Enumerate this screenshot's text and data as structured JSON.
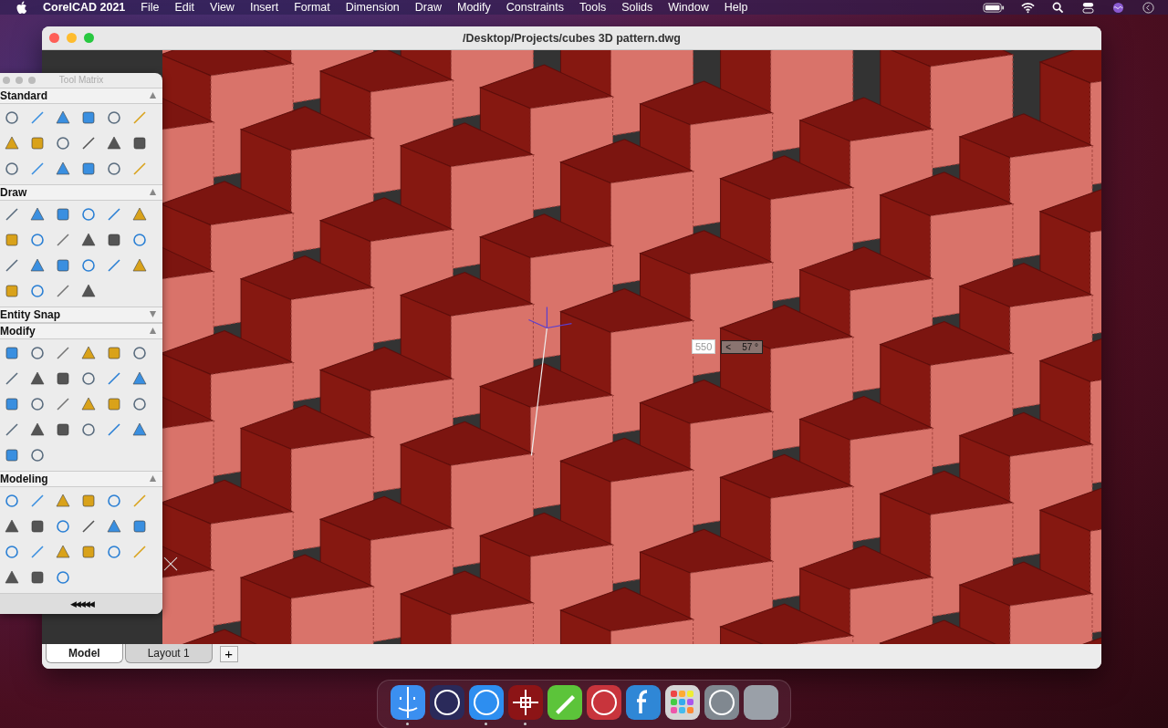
{
  "menu_bar": {
    "app": "CorelCAD 2021",
    "menus": [
      "File",
      "Edit",
      "View",
      "Insert",
      "Format",
      "Dimension",
      "Draw",
      "Modify",
      "Constraints",
      "Tools",
      "Solids",
      "Window",
      "Help"
    ]
  },
  "window": {
    "title": "/Desktop/Projects/cubes 3D pattern.dwg"
  },
  "dimension_input": {
    "value": "550",
    "angle_prefix": "<",
    "angle": "57 °"
  },
  "tool_matrix": {
    "title": "Tool Matrix",
    "sections": [
      {
        "label": "Standard",
        "expanded": true
      },
      {
        "label": "Draw",
        "expanded": true
      },
      {
        "label": "Entity Snap",
        "expanded": false
      },
      {
        "label": "Modify",
        "expanded": true
      },
      {
        "label": "Modeling",
        "expanded": true
      }
    ],
    "footer": "◀◀◀◀◀"
  },
  "tabs": [
    {
      "label": "Model",
      "selected": true
    },
    {
      "label": "Layout 1",
      "selected": false
    }
  ],
  "add_tab": "+",
  "dock": [
    {
      "running": true
    },
    {
      "running": false
    },
    {
      "running": true
    },
    {
      "running": true
    },
    {
      "running": false
    },
    {
      "running": false
    },
    {
      "running": false
    },
    {
      "running": false
    },
    {
      "running": false
    },
    {
      "running": false
    }
  ]
}
